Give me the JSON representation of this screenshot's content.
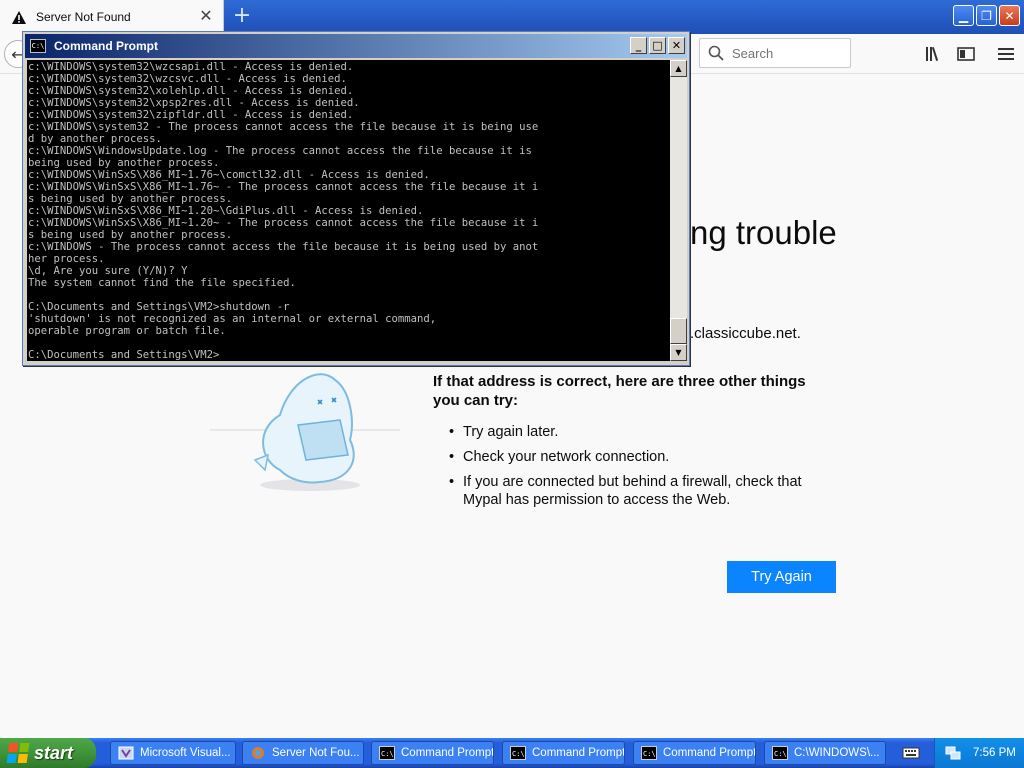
{
  "browser": {
    "tab_title": "Server Not Found",
    "new_tab_symbol": "+",
    "search_placeholder": "Search"
  },
  "error_page": {
    "title_fragment": "ng trouble",
    "host_fragment": ".classiccube.net.",
    "subtitle": "If that address is correct, here are three other things you can try:",
    "suggestions": [
      "Try again later.",
      "Check your network connection.",
      "If you are connected but behind a firewall, check that Mypal has permission to access the Web."
    ],
    "try_again_label": "Try Again"
  },
  "cmd": {
    "title": "Command Prompt",
    "icon_text": "C:\\",
    "output": "c:\\WINDOWS\\system32\\wzcsapi.dll - Access is denied.\nc:\\WINDOWS\\system32\\wzcsvc.dll - Access is denied.\nc:\\WINDOWS\\system32\\xolehlp.dll - Access is denied.\nc:\\WINDOWS\\system32\\xpsp2res.dll - Access is denied.\nc:\\WINDOWS\\system32\\zipfldr.dll - Access is denied.\nc:\\WINDOWS\\system32 - The process cannot access the file because it is being use\nd by another process.\nc:\\WINDOWS\\WindowsUpdate.log - The process cannot access the file because it is\nbeing used by another process.\nc:\\WINDOWS\\WinSxS\\X86_MI~1.76~\\comctl32.dll - Access is denied.\nc:\\WINDOWS\\WinSxS\\X86_MI~1.76~ - The process cannot access the file because it i\ns being used by another process.\nc:\\WINDOWS\\WinSxS\\X86_MI~1.20~\\GdiPlus.dll - Access is denied.\nc:\\WINDOWS\\WinSxS\\X86_MI~1.20~ - The process cannot access the file because it i\ns being used by another process.\nc:\\WINDOWS - The process cannot access the file because it is being used by anot\nher process.\n\\d, Are you sure (Y/N)? Y\nThe system cannot find the file specified.\n\nC:\\Documents and Settings\\VM2>shutdown -r\n'shutdown' is not recognized as an internal or external command,\noperable program or batch file.\n\nC:\\Documents and Settings\\VM2>"
  },
  "taskbar": {
    "start_label": "start",
    "tasks": [
      "Microsoft Visual...",
      "Server Not Fou...",
      "Command Prompt",
      "Command Prompt",
      "Command Prompt",
      "C:\\WINDOWS\\..."
    ],
    "clock": "7:56 PM"
  },
  "colors": {
    "accent_button": "#0a84ff",
    "console_bg": "#000000",
    "console_text": "#c0c0c0",
    "taskbar_blue": "#245edb",
    "start_green": "#3c8f36"
  }
}
